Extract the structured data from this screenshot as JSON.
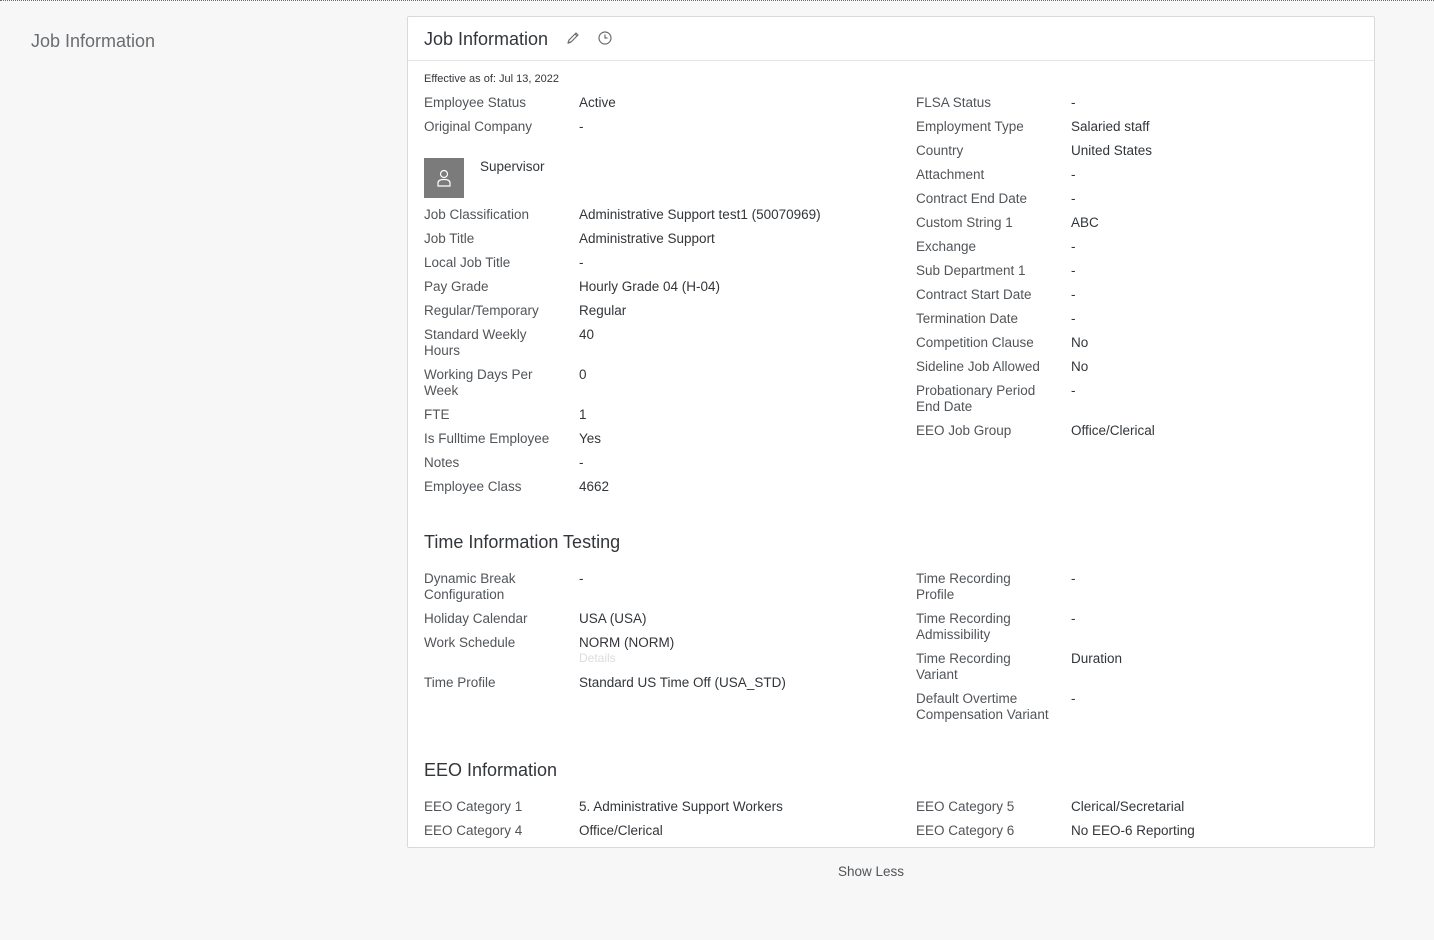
{
  "side_title": "Job Information",
  "card": {
    "title": "Job Information",
    "effective": "Effective as of: Jul 13, 2022",
    "icons": {
      "edit": "pencil-icon",
      "history": "history-clock-icon"
    }
  },
  "supervisor": {
    "label": "Supervisor",
    "avatar_icon": "person-icon"
  },
  "job_left": [
    {
      "label": "Employee Status",
      "value": "Active"
    },
    {
      "label": "Original Company",
      "value": "-"
    },
    {
      "label": "Job Classification",
      "value": "Administrative Support test1 (50070969)"
    },
    {
      "label": "Job Title",
      "value": "Administrative Support"
    },
    {
      "label": "Local Job Title",
      "value": "-"
    },
    {
      "label": "Pay Grade",
      "value": "Hourly Grade 04 (H-04)"
    },
    {
      "label": "Regular/Temporary",
      "value": "Regular"
    },
    {
      "label": "Standard Weekly Hours",
      "value": "40"
    },
    {
      "label": "Working Days Per Week",
      "value": "0"
    },
    {
      "label": "FTE",
      "value": "1"
    },
    {
      "label": "Is Fulltime Employee",
      "value": "Yes"
    },
    {
      "label": "Notes",
      "value": "-"
    },
    {
      "label": "Employee Class",
      "value": "4662"
    }
  ],
  "job_right": [
    {
      "label": "FLSA Status",
      "value": "-"
    },
    {
      "label": "Employment Type",
      "value": "Salaried staff"
    },
    {
      "label": "Country",
      "value": "United States"
    },
    {
      "label": "Attachment",
      "value": "-"
    },
    {
      "label": "Contract End Date",
      "value": "-"
    },
    {
      "label": "Custom String 1",
      "value": "ABC"
    },
    {
      "label": "Exchange",
      "value": "-"
    },
    {
      "label": "Sub Department 1",
      "value": "-"
    },
    {
      "label": "Contract Start Date",
      "value": "-"
    },
    {
      "label": "Termination Date",
      "value": "-"
    },
    {
      "label": "Competition Clause",
      "value": "No"
    },
    {
      "label": "Sideline Job Allowed",
      "value": "No"
    },
    {
      "label": "Probationary Period End Date",
      "value": "-"
    },
    {
      "label": "EEO Job Group",
      "value": "Office/Clerical"
    }
  ],
  "time_section": {
    "title": "Time Information Testing",
    "left": [
      {
        "label": "Dynamic Break Configuration",
        "value": "-"
      },
      {
        "label": "Holiday Calendar",
        "value": "USA (USA)"
      },
      {
        "label": "Work Schedule",
        "value": "NORM (NORM)"
      },
      {
        "label": "Time Profile",
        "value": "Standard US Time Off (USA_STD)"
      }
    ],
    "details_link": "Details",
    "right": [
      {
        "label": "Time Recording Profile",
        "value": "-"
      },
      {
        "label": "Time Recording Admissibility",
        "value": "-"
      },
      {
        "label": "Time Recording Variant",
        "value": "Duration"
      },
      {
        "label": "Default Overtime Compensation Variant",
        "value": "-"
      }
    ]
  },
  "eeo_section": {
    "title": "EEO Information",
    "left": [
      {
        "label": "EEO Category 1",
        "value": "5. Administrative Support Workers"
      },
      {
        "label": "EEO Category 4",
        "value": "Office/Clerical"
      }
    ],
    "right": [
      {
        "label": "EEO Category 5",
        "value": "Clerical/Secretarial"
      },
      {
        "label": "EEO Category 6",
        "value": "No EEO-6 Reporting"
      }
    ]
  },
  "show_less": "Show Less"
}
